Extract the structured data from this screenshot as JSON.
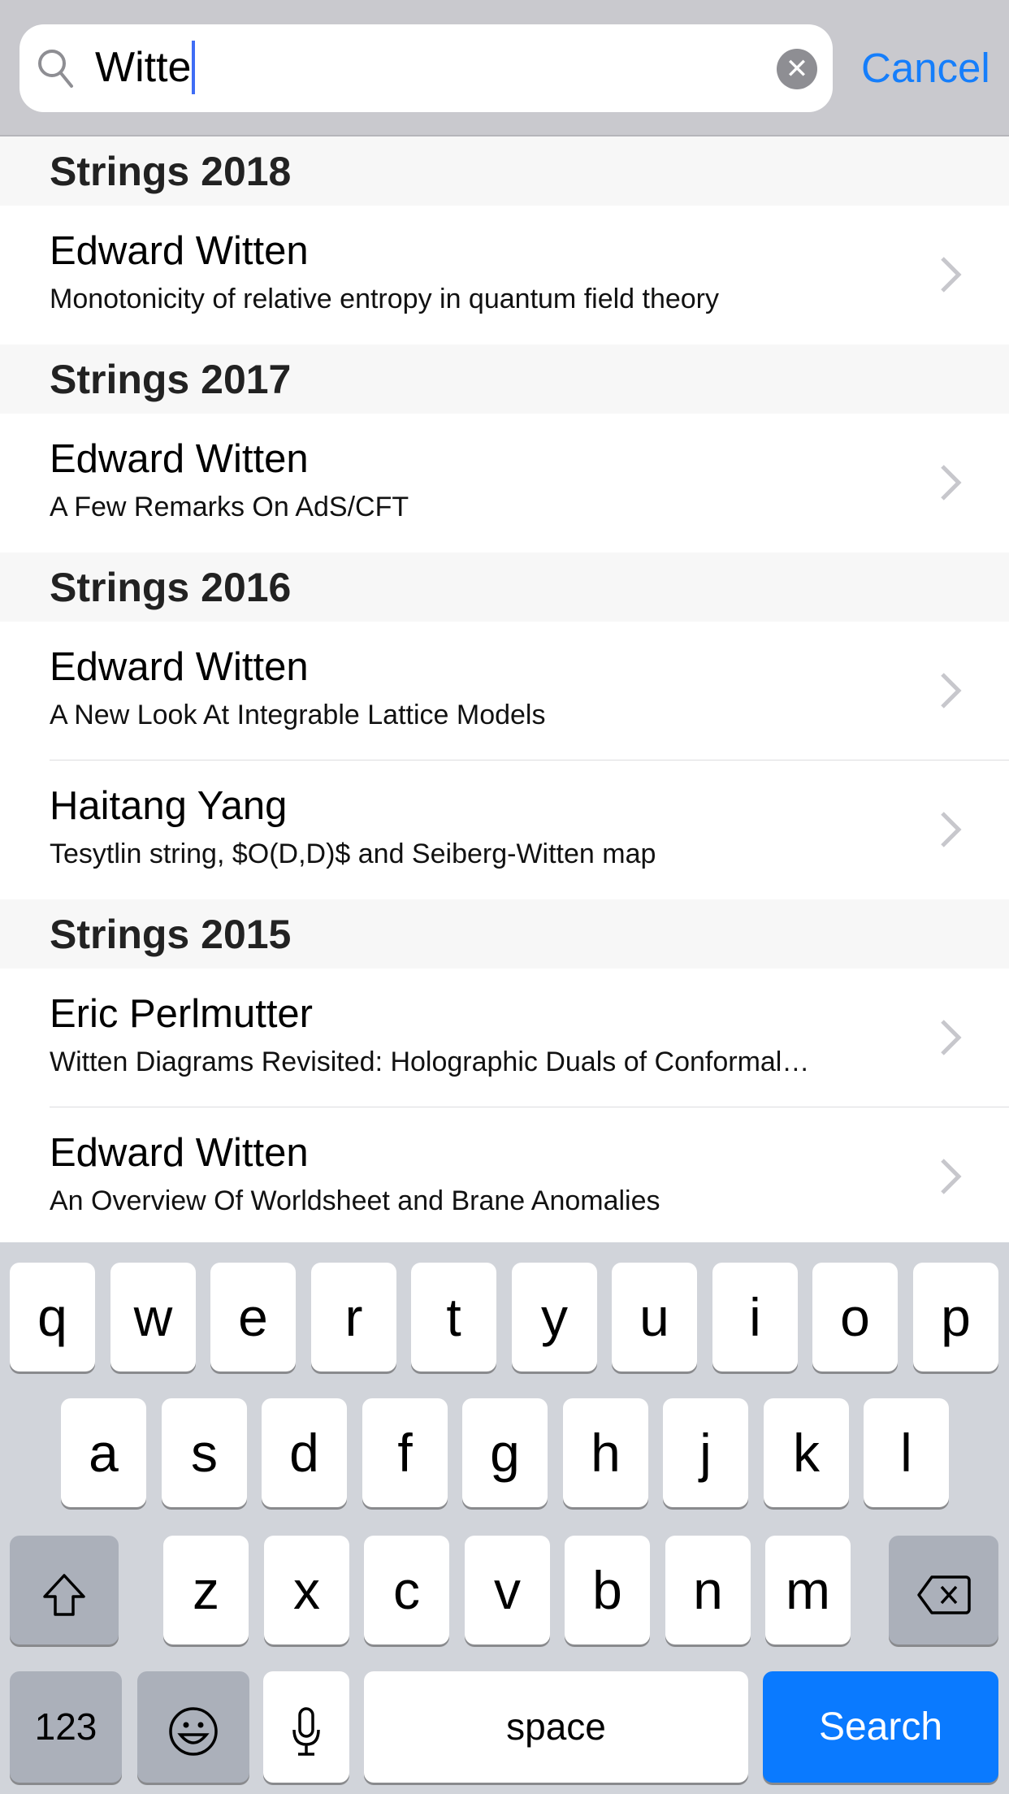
{
  "search": {
    "query": "Witte",
    "cancel_label": "Cancel"
  },
  "sections": [
    {
      "title": "Strings 2018",
      "items": [
        {
          "name": "Edward Witten",
          "talk": "Monotonicity of relative entropy in quantum field theory"
        }
      ]
    },
    {
      "title": "Strings 2017",
      "items": [
        {
          "name": "Edward Witten",
          "talk": "A Few Remarks On AdS/CFT"
        }
      ]
    },
    {
      "title": "Strings 2016",
      "items": [
        {
          "name": "Edward Witten",
          "talk": "A New Look At Integrable Lattice Models"
        },
        {
          "name": "Haitang Yang",
          "talk": "Tesytlin string, $O(D,D)$ and Seiberg-Witten map"
        }
      ]
    },
    {
      "title": "Strings 2015",
      "items": [
        {
          "name": "Eric Perlmutter",
          "talk": "Witten Diagrams Revisited: Holographic Duals of Conformal…"
        },
        {
          "name": "Edward Witten",
          "talk": "An Overview Of Worldsheet and Brane Anomalies"
        }
      ]
    }
  ],
  "keyboard": {
    "rows": [
      [
        "q",
        "w",
        "e",
        "r",
        "t",
        "y",
        "u",
        "i",
        "o",
        "p"
      ],
      [
        "a",
        "s",
        "d",
        "f",
        "g",
        "h",
        "j",
        "k",
        "l"
      ],
      [
        "z",
        "x",
        "c",
        "v",
        "b",
        "n",
        "m"
      ]
    ],
    "numbers_label": "123",
    "space_label": "space",
    "search_label": "Search",
    "accent_color": "#0a7aff"
  }
}
